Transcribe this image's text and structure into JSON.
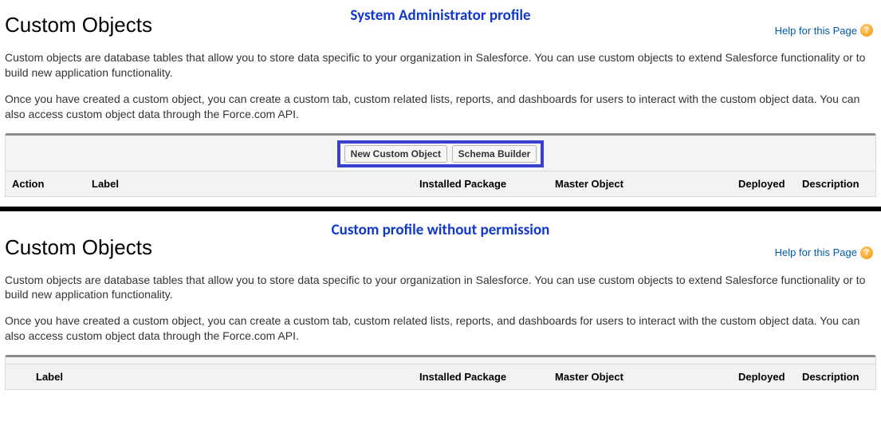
{
  "sectionA": {
    "caption": "System Administrator profile",
    "title": "Custom Objects",
    "help_label": "Help for this Page",
    "para1": "Custom objects are database tables that allow you to store data specific to your organization in Salesforce. You can use custom objects to extend Salesforce functionality or to build new application functionality.",
    "para2": "Once you have created a custom object, you can create a custom tab, custom related lists, reports, and dashboards for users to interact with the custom object data. You can also access custom object data through the Force.com API.",
    "btn_new": "New Custom Object",
    "btn_schema": "Schema Builder",
    "cols": {
      "action": "Action",
      "label": "Label",
      "package": "Installed Package",
      "master": "Master Object",
      "deployed": "Deployed",
      "desc": "Description"
    }
  },
  "sectionB": {
    "caption": "Custom profile without permission",
    "title": "Custom Objects",
    "help_label": "Help for this Page",
    "para1": "Custom objects are database tables that allow you to store data specific to your organization in Salesforce. You can use custom objects to extend Salesforce functionality or to build new application functionality.",
    "para2": "Once you have created a custom object, you can create a custom tab, custom related lists, reports, and dashboards for users to interact with the custom object data. You can also access custom object data through the Force.com API.",
    "cols": {
      "label": "Label",
      "package": "Installed Package",
      "master": "Master Object",
      "deployed": "Deployed",
      "desc": "Description"
    }
  }
}
